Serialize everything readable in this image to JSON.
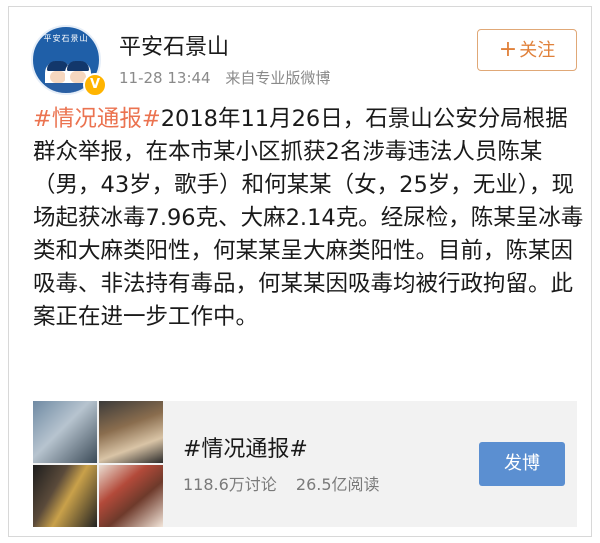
{
  "account": {
    "name": "平安石景山",
    "avatar_text": "平安石景山",
    "time": "11-28 13:44",
    "source": "来自专业版微博"
  },
  "follow_button": {
    "plus": "+",
    "label": "关注"
  },
  "post": {
    "topic": "#情况通报#",
    "body": "2018年11月26日，石景山公安分局根据群众举报，在本市某小区抓获2名涉毒违法人员陈某（男，43岁，歌手）和何某某（女，25岁，无业），现场起获冰毒7.96克、大麻2.14克。经尿检，陈某呈冰毒类和大麻类阳性，何某某呈大麻类阳性。目前，陈某因吸毒、非法持有毒品，何某某因吸毒均被行政拘留。此案正在进一步工作中。"
  },
  "topic_card": {
    "title": "#情况通报#",
    "discussions": "118.6万讨论",
    "reads": "26.5亿阅读",
    "post_button": "发博"
  },
  "colors": {
    "topic": "#eb7350",
    "follow": "#e0813b",
    "verified_badge": "#ffb400",
    "post_button": "#5b8fd1"
  },
  "icons": {
    "verified": "verified-v-icon",
    "avatar": "police-avatar-icon"
  }
}
